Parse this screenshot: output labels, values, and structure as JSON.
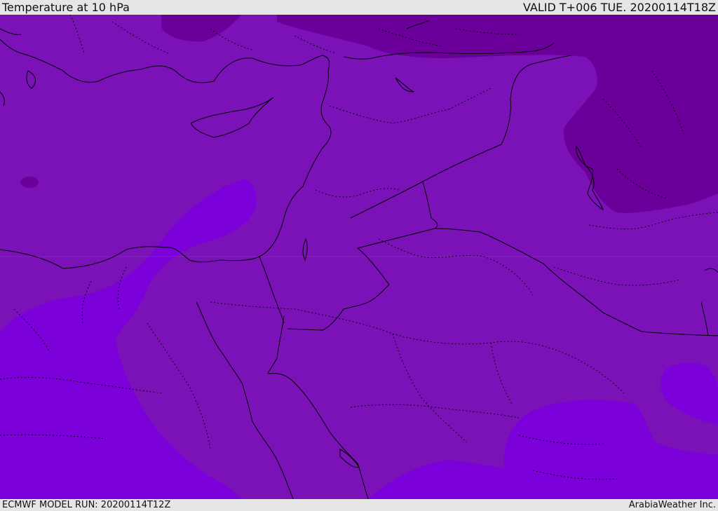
{
  "header": {
    "title": "Temperature at 10 hPa",
    "valid": "VALID T+006 TUE. 20200114T18Z"
  },
  "footer": {
    "model_run": "ECMWF MODEL RUN: 20200114T12Z",
    "credit": "ArabiaWeather Inc."
  },
  "colors": {
    "base": "#7a12b8",
    "warm": "#7c00da",
    "cold": "#6a0099",
    "outline": "#000000"
  }
}
